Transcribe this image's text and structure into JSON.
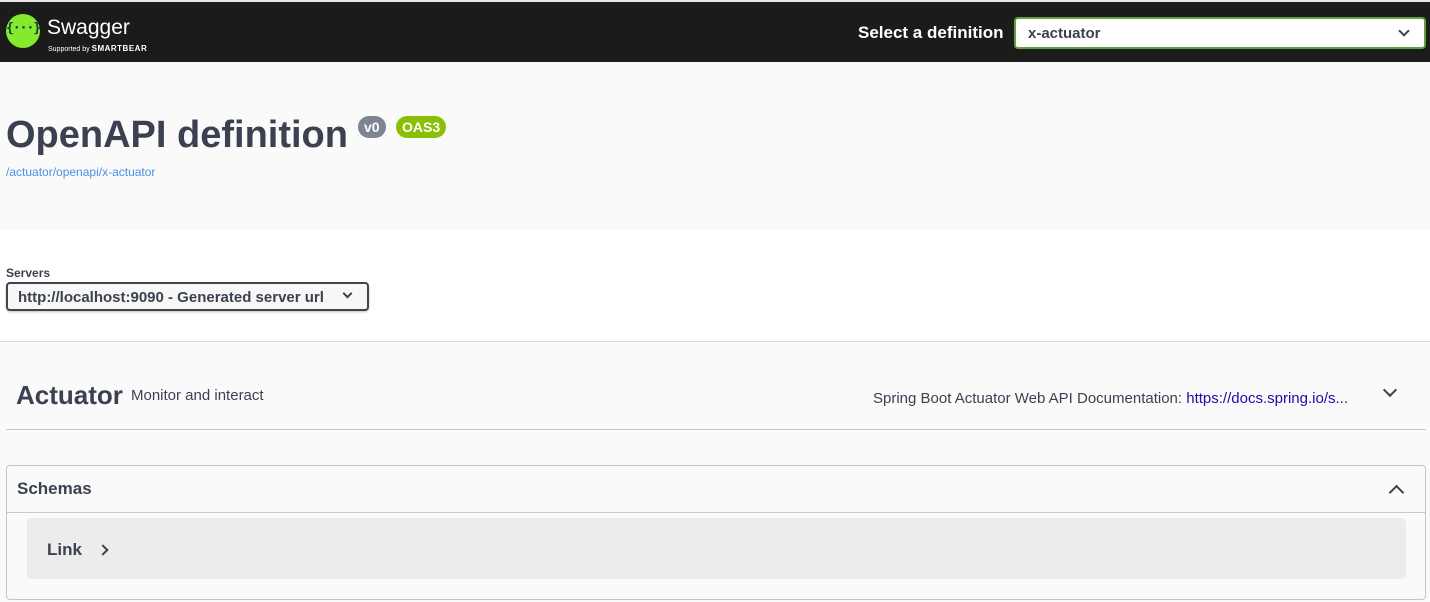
{
  "topbar": {
    "brand": "Swagger",
    "brand_sub_prefix": "Supported by",
    "brand_sub_company": "SMARTBEAR",
    "logo_glyph": "{···}",
    "definition_label": "Select a definition",
    "definition_value": "x-actuator",
    "bg_color": "#1b1b1b",
    "accent_color": "#85ea2d"
  },
  "info": {
    "title": "OpenAPI definition",
    "version_badge": "v0",
    "oas_badge": "OAS3",
    "spec_url": "/actuator/openapi/x-actuator"
  },
  "servers": {
    "label": "Servers",
    "selected": "http://localhost:9090 - Generated server url"
  },
  "tag": {
    "name": "Actuator",
    "description": "Monitor and interact",
    "external_docs_prefix": "Spring Boot Actuator Web API Documentation: ",
    "external_docs_link": "https://docs.spring.io/s..."
  },
  "schemas": {
    "title": "Schemas",
    "models": [
      {
        "name": "Link"
      }
    ]
  }
}
